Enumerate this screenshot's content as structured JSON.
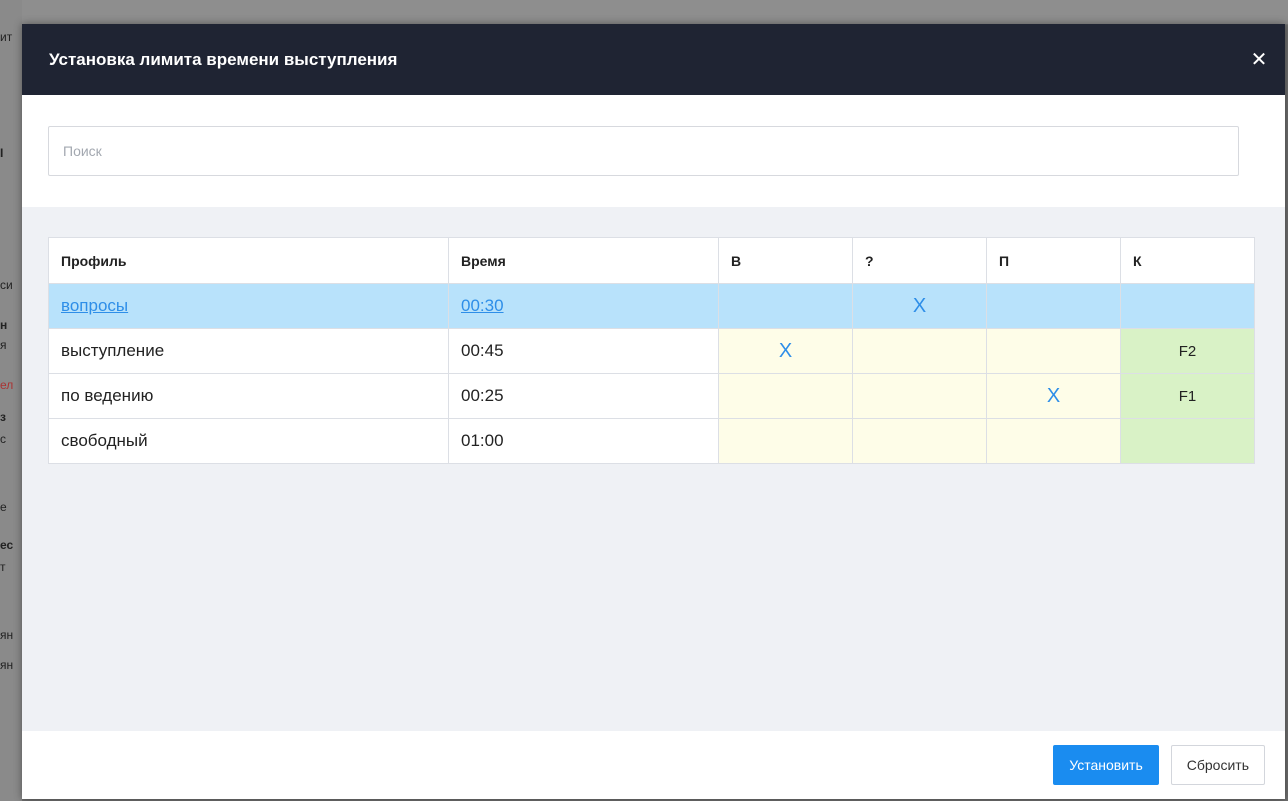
{
  "background": {
    "fragments": [
      "ит",
      "I",
      "си",
      "н",
      "я",
      "ел",
      "з",
      "с",
      "е",
      "ес",
      "т",
      "ян",
      "ян"
    ]
  },
  "modal": {
    "title": "Установка лимита времени выступления",
    "close_glyph": "✕",
    "search_placeholder": "Поиск",
    "search_value": ""
  },
  "table": {
    "headers": [
      "Профиль",
      "Время",
      "В",
      "?",
      "П",
      "К"
    ],
    "rows": [
      {
        "profile": "вопросы",
        "time": "00:30",
        "v": "",
        "q": "X",
        "p": "",
        "k": "",
        "selected": true
      },
      {
        "profile": "выступление",
        "time": "00:45",
        "v": "X",
        "q": "",
        "p": "",
        "k": "F2",
        "selected": false
      },
      {
        "profile": "по ведению",
        "time": "00:25",
        "v": "",
        "q": "",
        "p": "X",
        "k": "F1",
        "selected": false
      },
      {
        "profile": "свободный",
        "time": "01:00",
        "v": "",
        "q": "",
        "p": "",
        "k": "",
        "selected": false
      }
    ]
  },
  "footer": {
    "set_label": "Установить",
    "reset_label": "Сбросить"
  },
  "colors": {
    "header_bg": "#1f2433",
    "accent": "#1a8cf0",
    "selected_row": "#b8e2fb",
    "yellow_cell": "#fefde8",
    "green_cell": "#d9f2c6"
  }
}
